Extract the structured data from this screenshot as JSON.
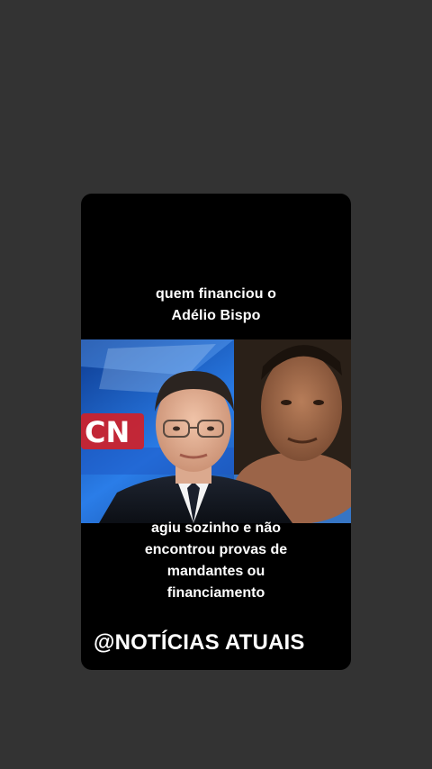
{
  "video": {
    "caption_top": [
      "quem financiou o",
      "Adélio Bispo"
    ],
    "caption_bottom": [
      "agiu sozinho e não",
      "encontrou provas de",
      "mandantes ou",
      "financiamento"
    ],
    "watermark": "@NOTÍCIAS ATUAIS",
    "logo_text": "CN"
  },
  "colors": {
    "page_background": "#333333",
    "card_background": "#000000",
    "caption_text": "#ffffff",
    "studio_blue": "#1565d8",
    "logo_red": "#d41f26"
  }
}
